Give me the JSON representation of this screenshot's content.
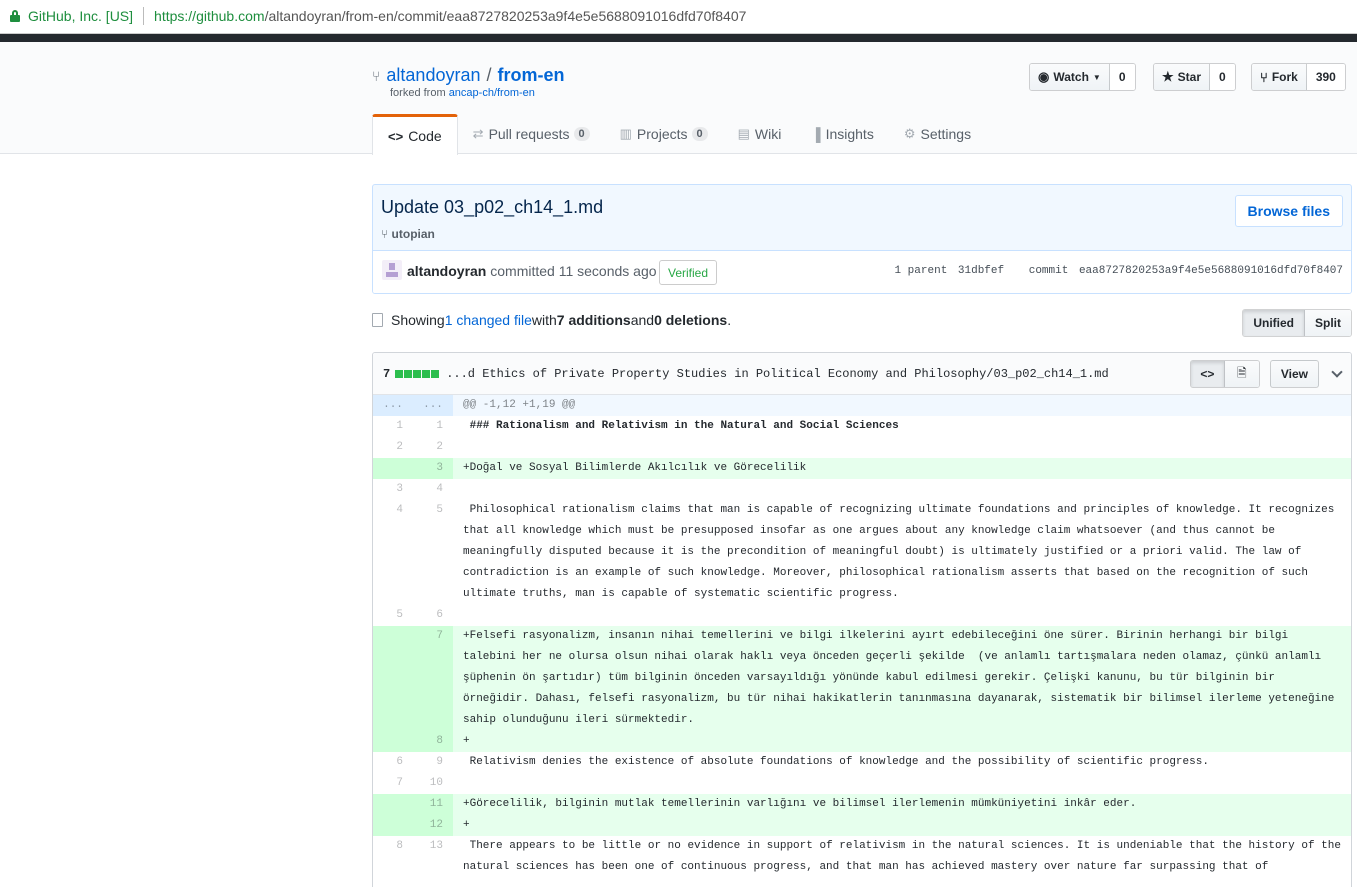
{
  "browser": {
    "org": "GitHub, Inc. [US]",
    "url_host": "https://github.com",
    "url_path": "/altandoyran/from-en/commit/eaa8727820253a9f4e5e5688091016dfd70f8407"
  },
  "repo": {
    "owner": "altandoyran",
    "slash": "/",
    "name": "from-en",
    "forked_prefix": "forked from ",
    "forked_link": "ancap-ch/from-en"
  },
  "actions": {
    "watch_label": "Watch",
    "watch_count": "0",
    "star_label": "Star",
    "star_count": "0",
    "fork_label": "Fork",
    "fork_count": "390"
  },
  "tabs": [
    {
      "label": "Code",
      "count": ""
    },
    {
      "label": "Pull requests",
      "count": "0"
    },
    {
      "label": "Projects",
      "count": "0"
    },
    {
      "label": "Wiki",
      "count": ""
    },
    {
      "label": "Insights",
      "count": ""
    },
    {
      "label": "Settings",
      "count": ""
    }
  ],
  "commit": {
    "title": "Update 03_p02_ch14_1.md",
    "branch": "utopian",
    "browse_files": "Browse files",
    "author": "altandoyran",
    "committed": "committed 11 seconds ago",
    "verified": "Verified",
    "parent_label": "1 parent",
    "parent_sha": "31dbfef",
    "commit_label": "commit",
    "commit_sha": "eaa8727820253a9f4e5e5688091016dfd70f8407"
  },
  "toc": {
    "showing": "Showing ",
    "changed": "1 changed file",
    "with": " with ",
    "additions": "7 additions",
    "and": " and ",
    "deletions": "0 deletions",
    "end": ".",
    "unified": "Unified",
    "split": "Split"
  },
  "file": {
    "stat": "7",
    "path": "...d Ethics of Private Property Studies in Political Economy and Philosophy/03_p02_ch14_1.md",
    "view": "View"
  },
  "diff": {
    "hunk_left": "...",
    "hunk_right": "...",
    "hunk": "@@ -1,12 +1,19 @@",
    "lines": [
      {
        "l": "1",
        "r": "1",
        "type": "ctx",
        "text": " ### Rationalism and Relativism in the Natural and Social Sciences"
      },
      {
        "l": "2",
        "r": "2",
        "type": "ctx",
        "text": " "
      },
      {
        "l": "",
        "r": "3",
        "type": "add",
        "text": "+Doğal ve Sosyal Bilimlerde Akılcılık ve Görecelilik"
      },
      {
        "l": "3",
        "r": "4",
        "type": "ctx",
        "text": " "
      },
      {
        "l": "4",
        "r": "5",
        "type": "ctx",
        "text": " Philosophical rationalism claims that man is capable of recognizing ultimate foundations and principles of knowledge. It recognizes that all knowledge which must be presupposed insofar as one argues about any knowledge claim whatsoever (and thus cannot be meaningfully disputed because it is the precondition of meaningful doubt) is ultimately justified or a priori valid. The law of contradiction is an example of such knowledge. Moreover, philosophical rationalism asserts that based on the recognition of such ultimate truths, man is capable of systematic scientific progress."
      },
      {
        "l": "5",
        "r": "6",
        "type": "ctx",
        "text": " "
      },
      {
        "l": "",
        "r": "7",
        "type": "add",
        "text": "+Felsefi rasyonalizm, insanın nihai temellerini ve bilgi ilkelerini ayırt edebileceğini öne sürer. Birinin herhangi bir bilgi talebini her ne olursa olsun nihai olarak haklı veya önceden geçerli şekilde  (ve anlamlı tartışmalara neden olamaz, çünkü anlamlı şüphenin ön şartıdır) tüm bilginin önceden varsayıldığı yönünde kabul edilmesi gerekir. Çelişki kanunu, bu tür bilginin bir örneğidir. Dahası, felsefi rasyonalizm, bu tür nihai hakikatlerin tanınmasına dayanarak, sistematik bir bilimsel ilerleme yeteneğine sahip olunduğunu ileri sürmektedir."
      },
      {
        "l": "",
        "r": "8",
        "type": "add",
        "text": "+"
      },
      {
        "l": "6",
        "r": "9",
        "type": "ctx",
        "text": " Relativism denies the existence of absolute foundations of knowledge and the possibility of scientific progress."
      },
      {
        "l": "7",
        "r": "10",
        "type": "ctx",
        "text": " "
      },
      {
        "l": "",
        "r": "11",
        "type": "add",
        "text": "+Görecelilik, bilginin mutlak temellerinin varlığını ve bilimsel ilerlemenin mümküniyetini inkâr eder."
      },
      {
        "l": "",
        "r": "12",
        "type": "add",
        "text": "+"
      },
      {
        "l": "8",
        "r": "13",
        "type": "ctx",
        "text": " There appears to be little or no evidence in support of relativism in the natural sciences. It is undeniable that the history of the natural sciences has been one of continuous progress, and that man has achieved mastery over nature far surpassing that of"
      }
    ]
  },
  "colors": {
    "link": "#0366d6",
    "add_bg": "#e6ffed",
    "add_num_bg": "#cdffd8",
    "tab_accent": "#e36209",
    "verified": "#28a745"
  }
}
